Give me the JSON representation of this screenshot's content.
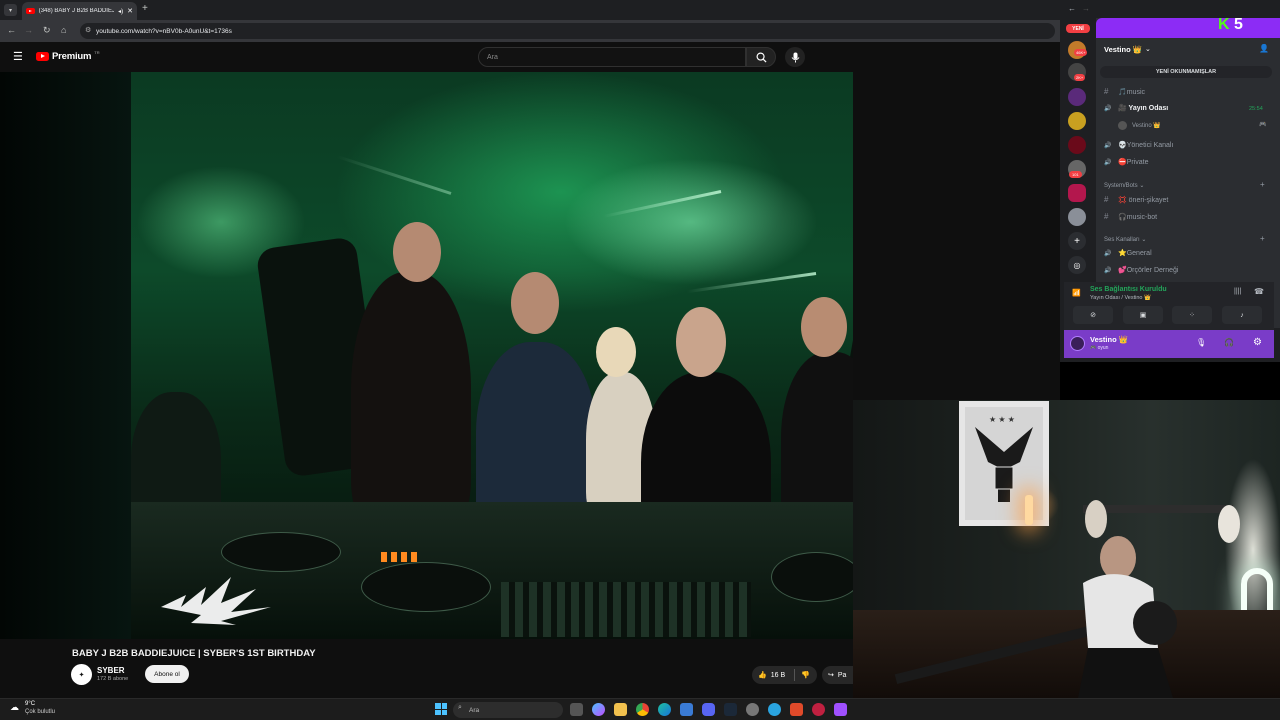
{
  "browser": {
    "tab_title": "(348) BABY J B2B BADDIEJUI",
    "url": "youtube.com/watch?v=nBV0b-A0unU&t=1736s",
    "new_tab_symbol": "+"
  },
  "youtube": {
    "logo_text": "Premium",
    "logo_badge": "TR",
    "search_placeholder": "Ara",
    "video_title": "BABY J B2B BADDIEJUICE | SYBER'S 1ST BIRTHDAY",
    "channel_name": "SYBER",
    "subscriber_count": "172 B abone",
    "subscribe_label": "Abone ol",
    "like_count": "16 B",
    "share_label": "Pa"
  },
  "taskbar": {
    "weather_temp": "9°C",
    "weather_desc": "Çok bulutlu",
    "search_placeholder": "Ara"
  },
  "discord": {
    "badges": {
      "new": "YENİ",
      "b1": "46K+",
      "b2": "2K+",
      "b3": "101"
    },
    "overlay_logo_k": "K",
    "overlay_logo_num": "5",
    "server_name": "Vestino 👑",
    "unread_button": "YENİ OKUNMAMIŞLAR",
    "channels": [
      {
        "icon": "#",
        "label": "🎵music"
      },
      {
        "icon": "🔊",
        "label": "🎥 Yayın Odası",
        "time": "25:54"
      },
      {
        "icon": "",
        "label": "Vestino 👑"
      },
      {
        "icon": "🔊",
        "label": "💀Yönetici Kanalı"
      },
      {
        "icon": "🔊",
        "label": "⛔Private"
      }
    ],
    "category_bots": "System/Bots",
    "bot_channels": [
      {
        "icon": "#",
        "label": "💢 öneri-şikayet"
      },
      {
        "icon": "#",
        "label": "🎧music-bot"
      }
    ],
    "category_voice": "Ses Kanalları",
    "voice_channels": [
      {
        "icon": "🔊",
        "label": "⭐General"
      },
      {
        "icon": "🔊",
        "label": "💕Orçörler Derneği"
      }
    ],
    "voice_status": "Ses Bağlantısı Kuruldu",
    "voice_location": "Yayın Odası / Vestino 👑",
    "user_name": "Vestino 👑",
    "user_status": "🎮 oyun",
    "accent": "#8c2cf5",
    "connected_color": "#23a55a"
  }
}
